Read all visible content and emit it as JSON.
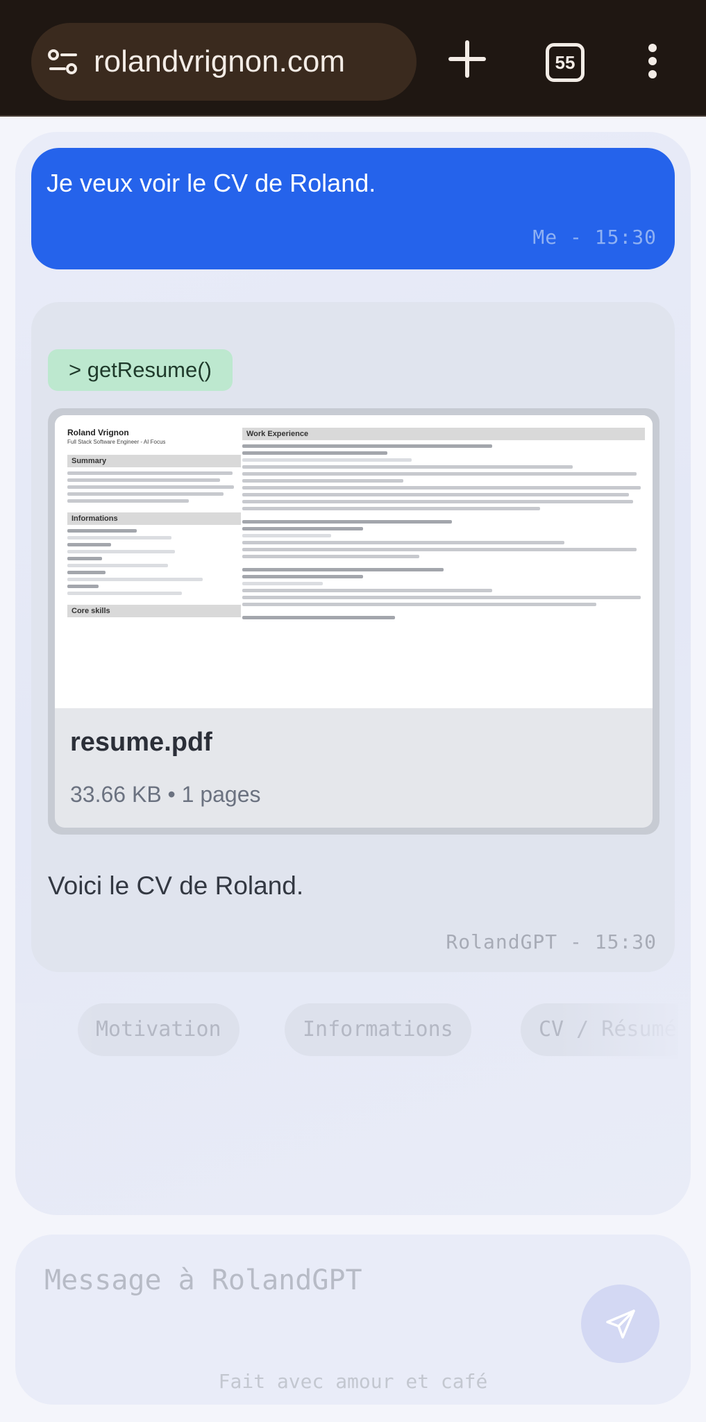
{
  "browser": {
    "url": "rolandvrignon.com",
    "tab_count": "55"
  },
  "chat": {
    "user_message": {
      "text": "Je veux voir le CV de Roland.",
      "meta": "Me - 15:30"
    },
    "bot_message": {
      "tool_call": "> getResume()",
      "attachment": {
        "preview": {
          "name": "Roland Vrignon",
          "subtitle": "Full Stack Software Engineer - AI Focus",
          "left_sections": [
            "Summary",
            "Informations",
            "Core skills"
          ],
          "right_section": "Work Experience"
        },
        "file_name": "resume.pdf",
        "file_meta": "33.66 KB • 1 pages"
      },
      "text": "Voici le CV de Roland.",
      "meta": "RolandGPT - 15:30"
    }
  },
  "suggestions": [
    "Motivation",
    "Informations",
    "CV / Résumé"
  ],
  "composer": {
    "placeholder": "Message à RolandGPT",
    "footer": "Fait avec amour et café"
  },
  "colors": {
    "user_bubble": "#2563eb",
    "tool_badge": "#bde8cf",
    "send_button": "#d3d8f3"
  }
}
